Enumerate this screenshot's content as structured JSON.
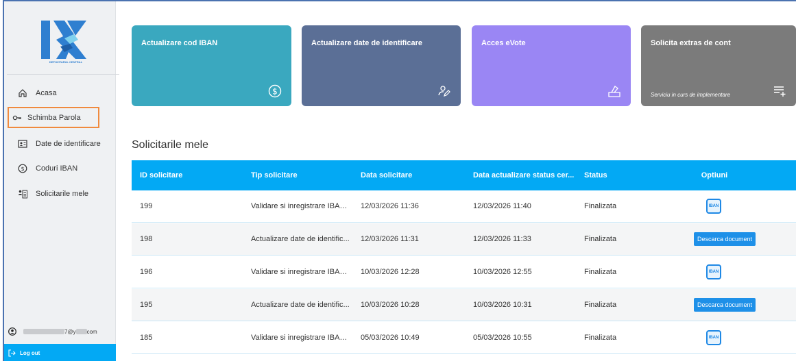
{
  "sidebar": {
    "logo_text": "DEPOZITARUL CENTRAL",
    "items": [
      {
        "label": "Acasa",
        "icon": "home-icon"
      },
      {
        "label": "Schimba Parola",
        "icon": "key-icon",
        "active": true
      },
      {
        "label": "Date de identificare",
        "icon": "id-card-icon"
      },
      {
        "label": "Coduri IBAN",
        "icon": "dollar-circle-icon"
      },
      {
        "label": "Solicitarile mele",
        "icon": "requests-icon"
      }
    ],
    "user_email_visible": "7@y",
    "user_email_suffix": "com",
    "logout_label": "Log out"
  },
  "cards": [
    {
      "title": "Actualizare cod IBAN",
      "icon": "dollar-circle-icon",
      "color": "#3aa8bf"
    },
    {
      "title": "Actualizare date de identificare",
      "icon": "user-edit-icon",
      "color": "#5b6f96"
    },
    {
      "title": "Acces eVote",
      "icon": "ballot-icon",
      "color": "#9a86f4"
    },
    {
      "title": "Solicita extras de cont",
      "icon": "list-add-icon",
      "color": "#7b7b7b",
      "note": "Serviciu in curs de implementare"
    }
  ],
  "requests": {
    "title": "Solicitarile mele",
    "columns": [
      "ID solicitare",
      "Tip solicitare",
      "Data solicitare",
      "Data actualizare status cer...",
      "Status",
      "Optiuni"
    ],
    "rows": [
      {
        "id": "199",
        "tip": "Validare si inregistrare IBAN...",
        "data": "12/03/2026 11:36",
        "upd": "12/03/2026 11:40",
        "status": "Finalizata",
        "option": "iban"
      },
      {
        "id": "198",
        "tip": "Actualizare date de identific...",
        "data": "12/03/2026 11:31",
        "upd": "12/03/2026 11:33",
        "status": "Finalizata",
        "option": "download"
      },
      {
        "id": "196",
        "tip": "Validare si inregistrare IBAN...",
        "data": "10/03/2026 12:28",
        "upd": "10/03/2026 12:55",
        "status": "Finalizata",
        "option": "iban"
      },
      {
        "id": "195",
        "tip": "Actualizare date de identific...",
        "data": "10/03/2026 10:28",
        "upd": "10/03/2026 10:31",
        "status": "Finalizata",
        "option": "download"
      },
      {
        "id": "185",
        "tip": "Validare si inregistrare IBAN...",
        "data": "05/03/2026 10:49",
        "upd": "05/03/2026 10:55",
        "status": "Finalizata",
        "option": "iban"
      }
    ],
    "download_label": "Descarca document",
    "iban_label": "IBAN"
  },
  "colors": {
    "accent": "#03a9f4",
    "active_outline": "#f08a3e"
  }
}
